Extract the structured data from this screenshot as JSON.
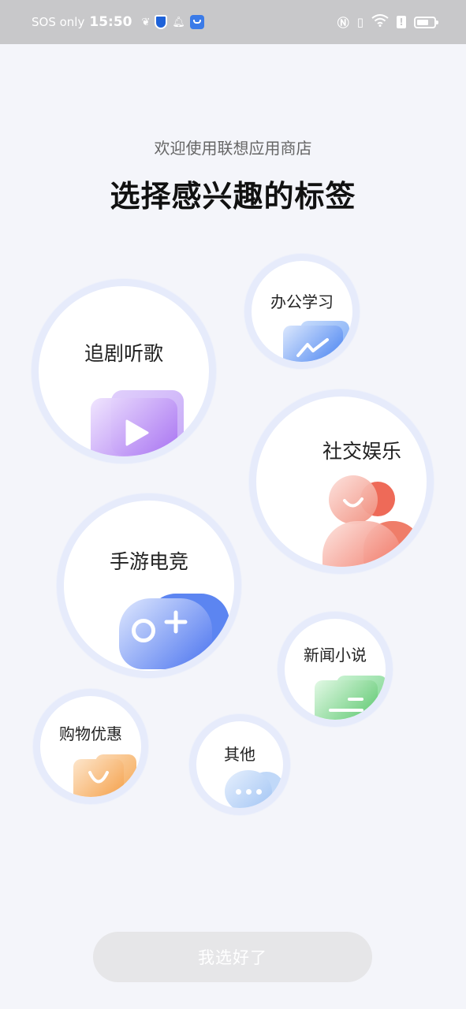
{
  "status_bar": {
    "carrier": "SOS only",
    "time": "15:50"
  },
  "header": {
    "subtitle": "欢迎使用联想应用商店",
    "title": "选择感兴趣的标签"
  },
  "tags": [
    {
      "label": "追剧听歌",
      "icon": "video-play-icon",
      "color": "#a36bf0"
    },
    {
      "label": "办公学习",
      "icon": "chart-trend-icon",
      "color": "#3f7ef0"
    },
    {
      "label": "社交娱乐",
      "icon": "people-icon",
      "color": "#ee5a4b"
    },
    {
      "label": "手游电竞",
      "icon": "gamepad-icon",
      "color": "#3f6ef0"
    },
    {
      "label": "新闻小说",
      "icon": "news-icon",
      "color": "#55c96a"
    },
    {
      "label": "购物优惠",
      "icon": "shopping-bag-icon",
      "color": "#f59a3c"
    },
    {
      "label": "其他",
      "icon": "more-dots-icon",
      "color": "#8fb9f3"
    }
  ],
  "footer": {
    "confirm_label": "我选好了"
  }
}
